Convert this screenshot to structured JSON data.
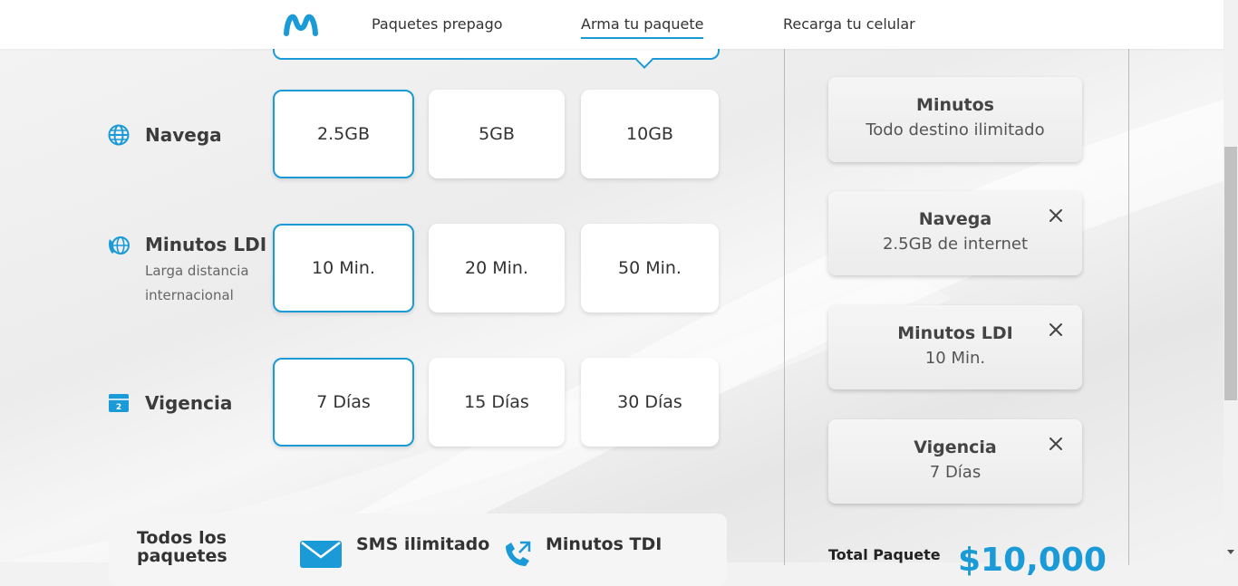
{
  "header": {
    "nav": [
      {
        "label": "Paquetes prepago",
        "active": false
      },
      {
        "label": "Arma tu paquete",
        "active": true
      },
      {
        "label": "Recarga tu celular",
        "active": false
      }
    ]
  },
  "rows": [
    {
      "title": "Navega",
      "subtitle": "",
      "icon": "globe-icon",
      "options": [
        "2.5GB",
        "5GB",
        "10GB"
      ],
      "selected": 0
    },
    {
      "title": "Minutos LDI",
      "subtitle": "Larga distancia internacional",
      "icon": "international-call-icon",
      "options": [
        "10 Min.",
        "20 Min.",
        "50 Min."
      ],
      "selected": 0
    },
    {
      "title": "Vigencia",
      "subtitle": "",
      "icon": "calendar-icon",
      "options": [
        "7 Días",
        "15 Días",
        "30 Días"
      ],
      "selected": 0
    }
  ],
  "included": {
    "title": "Todos los paquetes",
    "features": [
      {
        "label": "SMS ilimitado",
        "icon": "envelope-icon"
      },
      {
        "label": "Minutos TDI",
        "icon": "phone-transfer-icon"
      }
    ]
  },
  "summary": {
    "cards": [
      {
        "title": "Minutos",
        "value": "Todo destino ilimitado",
        "removable": false
      },
      {
        "title": "Navega",
        "value": "2.5GB de internet",
        "removable": true
      },
      {
        "title": "Minutos LDI",
        "value": "10 Min.",
        "removable": true
      },
      {
        "title": "Vigencia",
        "value": "7 Días",
        "removable": true
      }
    ],
    "total_label": "Total Paquete",
    "total_amount": "$10,000"
  },
  "colors": {
    "accent": "#1a9ad6",
    "background": "#f2f2f2",
    "text": "#333333"
  }
}
